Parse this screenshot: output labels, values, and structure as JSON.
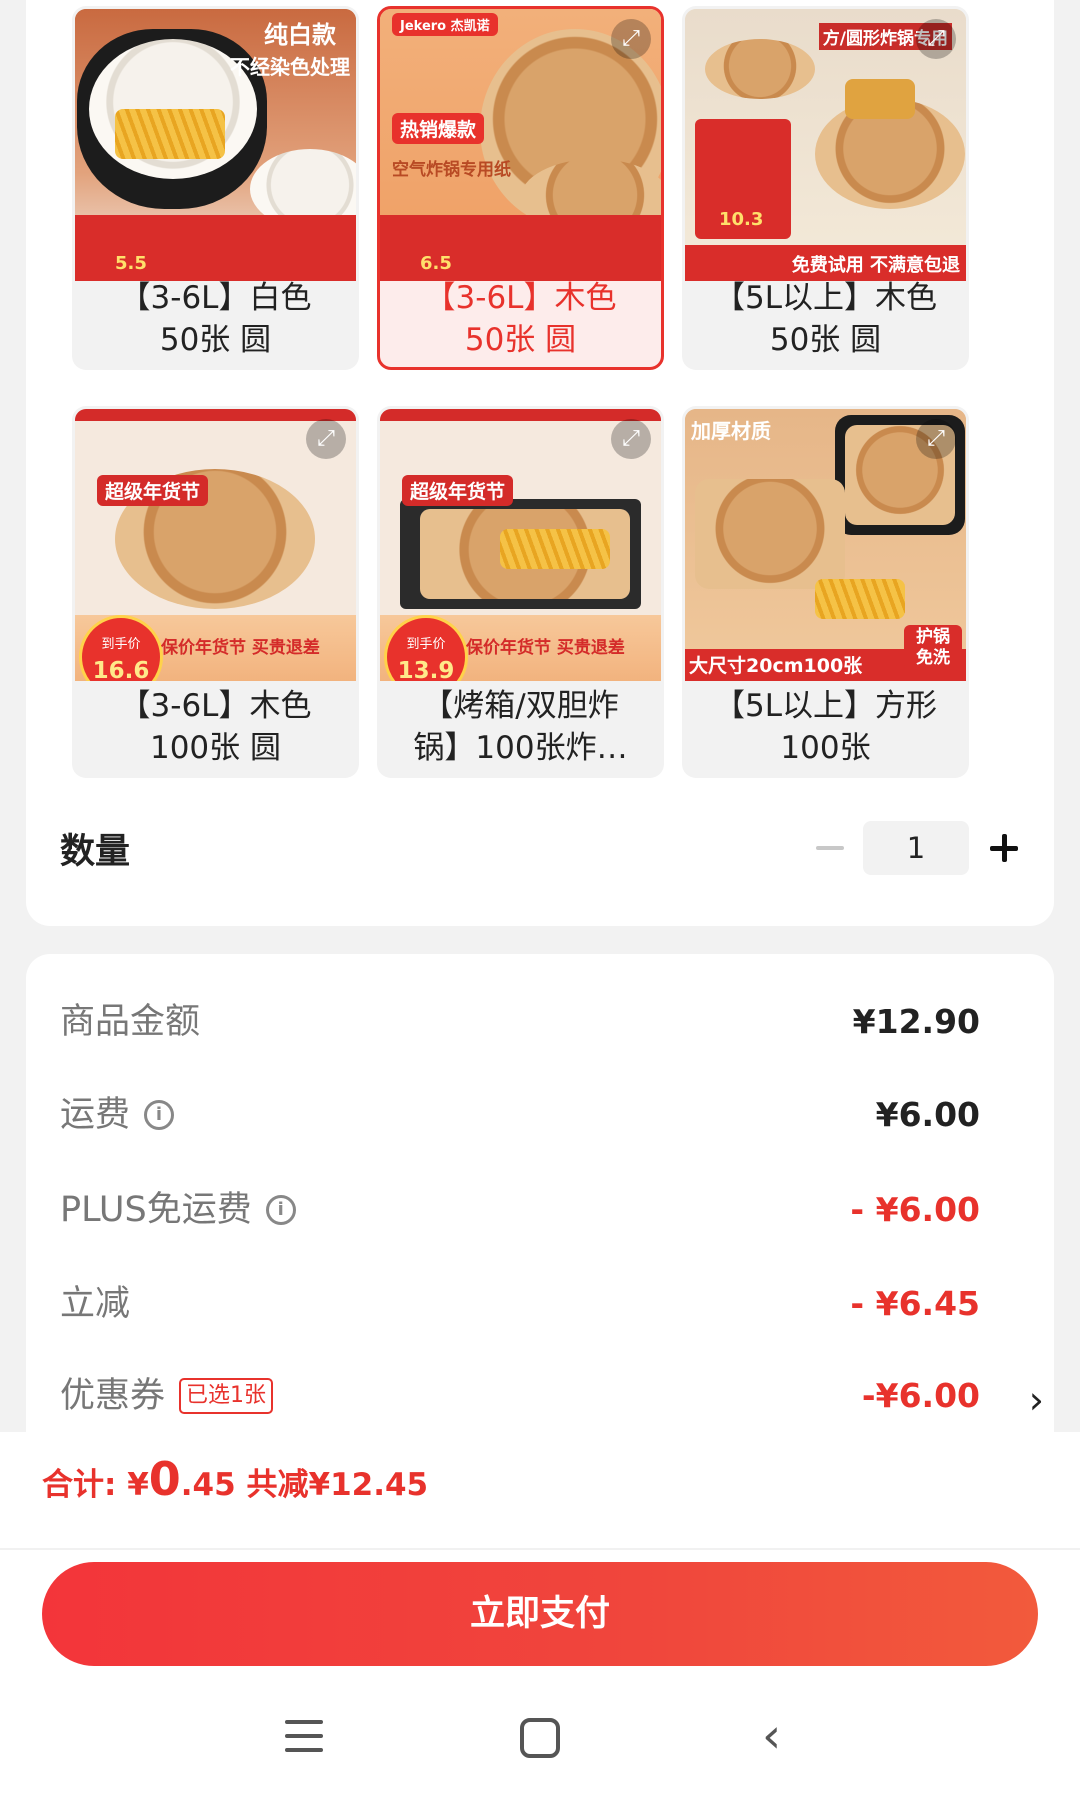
{
  "variants": [
    {
      "label_line1": "【3-6L】白色",
      "label_line2": "50张 圆",
      "selected": false,
      "img_text1": "纯白款",
      "img_text2": "不经染色处理",
      "price": "5.5"
    },
    {
      "label_line1": "【3-6L】木色",
      "label_line2": "50张 圆",
      "selected": true,
      "img_text1": "热销爆款",
      "img_text2": "空气炸锅专用纸",
      "brand": "Jekero 杰凯诺",
      "price": "6.5"
    },
    {
      "label_line1": "【5L以上】木色",
      "label_line2": "50张 圆",
      "selected": false,
      "img_text1": "方/圆形炸锅专用",
      "img_text2": "免费试用 不满意包退",
      "price": "10.3"
    },
    {
      "label_line1": "【3-6L】木色",
      "label_line2": "100张 圆",
      "selected": false,
      "img_text1": "超级年货节",
      "img_text2": "保价年货节 买贵退差",
      "price": "16.6"
    },
    {
      "label_line1": "【烤箱/双胆炸",
      "label_line2": "锅】100张炸…",
      "selected": false,
      "img_text1": "超级年货节",
      "img_text2": "保价年货节 买贵退差",
      "price": "13.9"
    },
    {
      "label_line1": "【5L以上】方形",
      "label_line2": "100张",
      "selected": false,
      "img_text1": "加厚材质",
      "img_text2": "大尺寸20cm100张",
      "badge": "护锅免洗"
    }
  ],
  "quantity": {
    "label": "数量",
    "value": "1"
  },
  "price_rows": [
    {
      "name": "商品金额",
      "amount": "¥12.90",
      "red": false,
      "info": false
    },
    {
      "name": "运费",
      "amount": "¥6.00",
      "red": false,
      "info": true
    },
    {
      "name": "PLUS免运费",
      "amount": "- ¥6.00",
      "red": true,
      "info": true
    },
    {
      "name": "立减",
      "amount": "- ¥6.45",
      "red": true,
      "info": false
    },
    {
      "name": "优惠券",
      "amount": "-¥6.00",
      "red": true,
      "info": false,
      "badge": "已选1张"
    }
  ],
  "total": {
    "prefix": "合计: ¥",
    "integer": "0",
    "decimal": ".45",
    "saved": " 共减¥12.45"
  },
  "pay_button": "立即支付",
  "colors": {
    "accent": "#e8322c",
    "selected_bg": "#fdeceb",
    "card_bg": "#ffffff",
    "page_bg": "#f2f2f2"
  }
}
